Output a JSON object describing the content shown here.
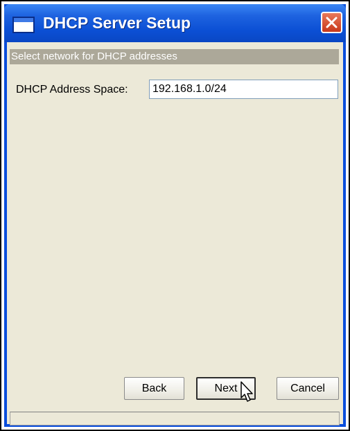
{
  "window": {
    "title": "DHCP Server Setup",
    "close_icon": "close-icon",
    "app_icon": "window-icon"
  },
  "header": {
    "text": "Select network for DHCP addresses"
  },
  "form": {
    "address_space_label": "DHCP Address Space:",
    "address_space_value": "192.168.1.0/24"
  },
  "buttons": {
    "back": "Back",
    "next": "Next",
    "cancel": "Cancel"
  },
  "statusbar": {
    "text": ""
  },
  "colors": {
    "titlebar": "#0b4fd4",
    "dialog_bg": "#ece9d8",
    "header_strip": "#aca899",
    "close_button": "#d9532f"
  }
}
